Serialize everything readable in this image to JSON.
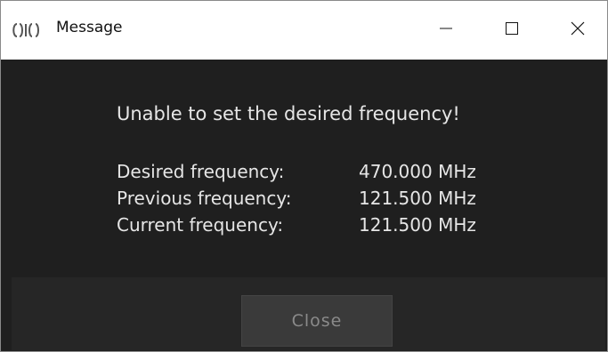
{
  "window": {
    "title": "Message",
    "icon": "app-logo-icon",
    "controls": [
      "minimize-icon",
      "maximize-icon",
      "close-icon"
    ]
  },
  "message": {
    "headline": "Unable to set the desired frequency!",
    "rows": [
      {
        "label": "Desired frequency:",
        "value": "470.000 MHz"
      },
      {
        "label": "Previous frequency:",
        "value": "121.500 MHz"
      },
      {
        "label": "Current frequency:",
        "value": "121.500 MHz"
      }
    ]
  },
  "footer": {
    "close_label": "Close"
  },
  "colors": {
    "background": "#1f1f1f",
    "text": "#e6e6e6",
    "button": "#3a3a3a",
    "button_text": "#8a8a8a"
  }
}
